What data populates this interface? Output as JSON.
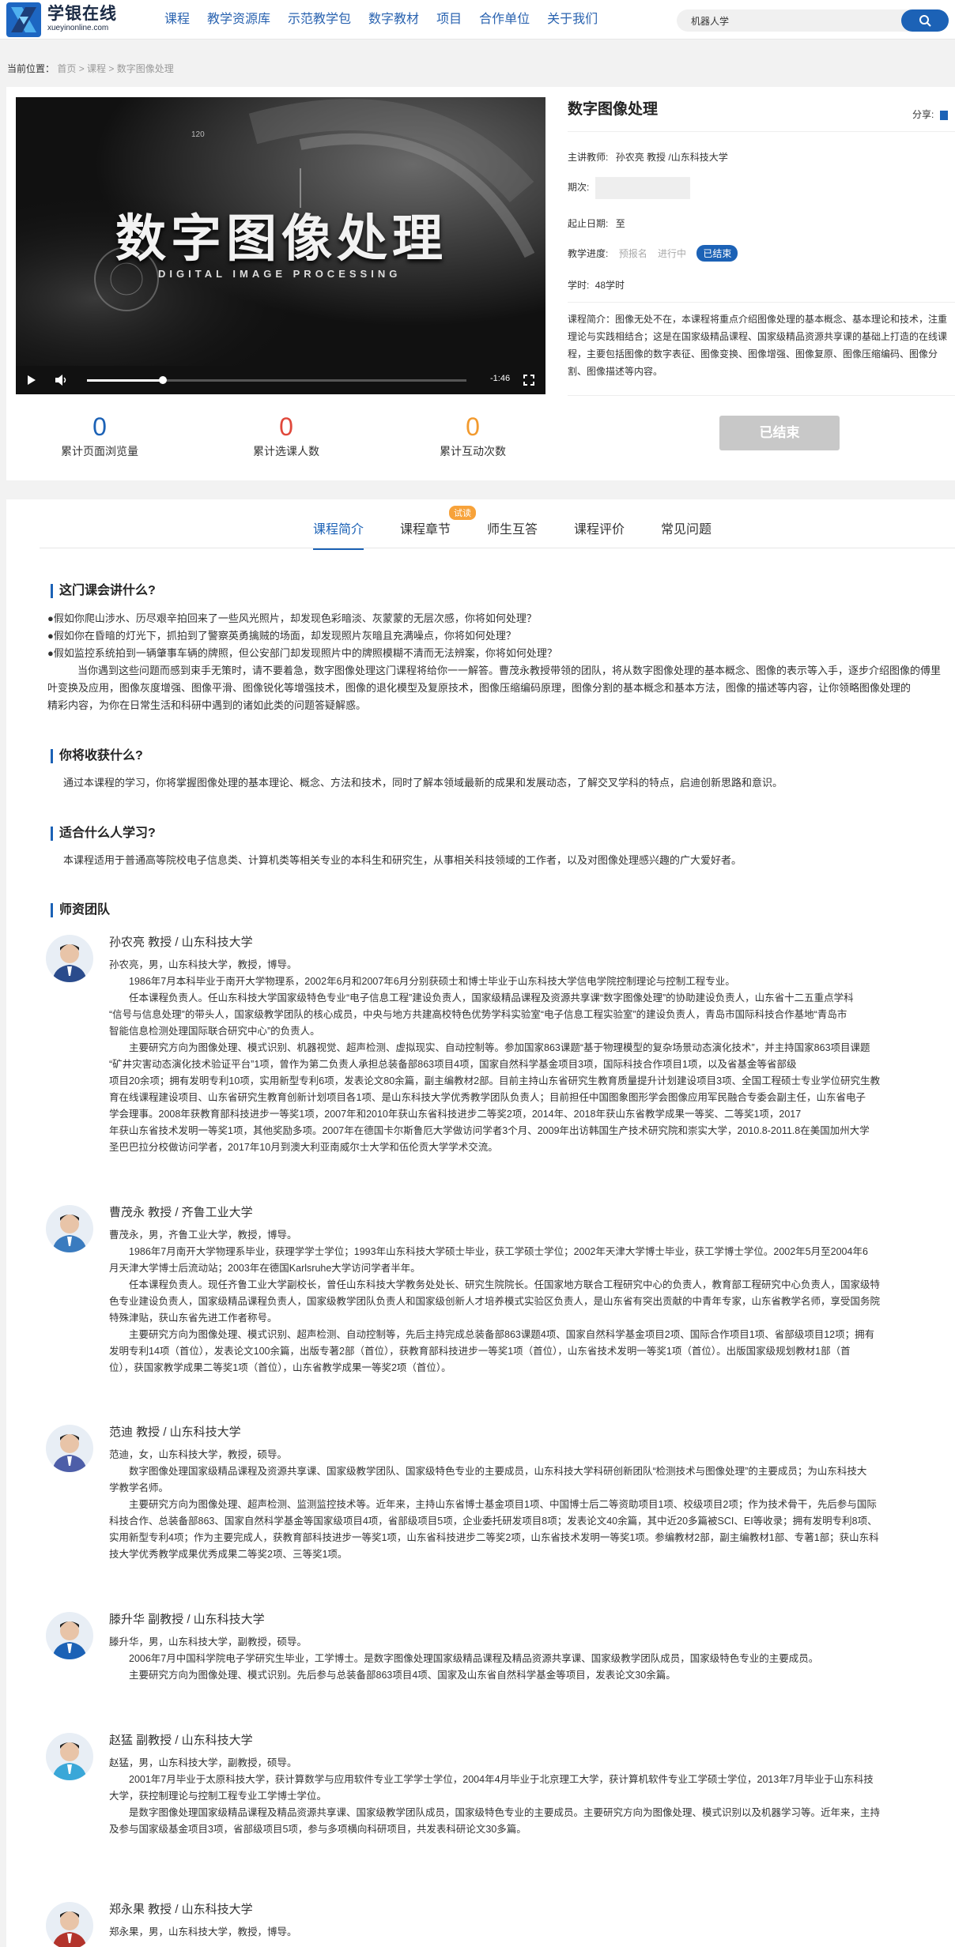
{
  "header": {
    "logo_title": "学银在线",
    "logo_sub": "xueyinonline.com",
    "nav": [
      "课程",
      "教学资源库",
      "示范教学包",
      "数字教材",
      "项目",
      "合作单位",
      "关于我们"
    ],
    "search_value": "机器人学"
  },
  "breadcrumb": {
    "label": "当前位置：",
    "path": "首页 > 课程 > 数字图像处理"
  },
  "video": {
    "title": "数字图像处理",
    "subtitle": "DIGITAL IMAGE PROCESSING",
    "num": "120",
    "time": "-1:46",
    "progress": 0.2
  },
  "course": {
    "title": "数字图像处理",
    "share": "分享:",
    "teacher_label": "主讲教师:",
    "teacher": "孙农亮 教授 /山东科技大学",
    "period_label": "期次:",
    "date_label": "起止日期:",
    "date": "至",
    "progress_label": "教学进度:",
    "steps": [
      "预报名",
      "进行中",
      "已结束"
    ],
    "hours_label": "学时:",
    "hours": "48学时",
    "intro": "课程简介：图像无处不在，本课程将重点介绍图像处理的基本概念、基本理论和技术，注重理论与实践相结合；这是在国家级精品课程、国家级精品资源共享课的基础上打造的在线课程，主要包括图像的数字表征、图像变换、图像增强、图像复原、图像压缩编码、图像分割、图像描述等内容。",
    "end_button": "已结束"
  },
  "stats": [
    {
      "value": "0",
      "label": "累计页面浏览量",
      "color": "#1c62b6"
    },
    {
      "value": "0",
      "label": "累计选课人数",
      "color": "#e0483b"
    },
    {
      "value": "0",
      "label": "累计互动次数",
      "color": "#f29a2e"
    }
  ],
  "tabs": [
    "课程简介",
    "课程章节",
    "师生互答",
    "课程评价",
    "常见问题"
  ],
  "tab_badge": "试读",
  "sections": {
    "s1_title": "这门课会讲什么?",
    "s1_bullets": [
      "●假如你爬山涉水、历尽艰辛拍回来了一些风光照片，却发现色彩暗淡、灰蒙蒙的无层次感，你将如何处理？",
      "●假如你在昏暗的灯光下，抓拍到了警察英勇擒贼的场面，却发现照片灰暗且充满噪点，你将如何处理？",
      "●假如监控系统拍到一辆肇事车辆的牌照，但公安部门却发现照片中的牌照模糊不清而无法辨案，你将如何处理？"
    ],
    "s1_para_1": "当你遇到这些问题而感到束手无策时，请不要着急，数字图像处理这门课程将给你一一解答。曹茂永教授带领的团队，将从数字图像处理的基本概念、图像的表示等入手，逐步介绍图像的傅里",
    "s1_para_2": "叶变换及应用，图像灰度增强、图像平滑、图像锐化等增强技术，图像的退化模型及复原技术，图像压缩编码原理，图像分割的基本概念和基本方法，图像的描述等内容，让你领略图像处理的",
    "s1_para_3": "精彩内容，为你在日常生活和科研中遇到的诸如此类的问题答疑解惑。",
    "s2_title": "你将收获什么?",
    "s2_para": "通过本课程的学习，你将掌握图像处理的基本理论、概念、方法和技术，同时了解本领域最新的成果和发展动态，了解交叉学科的特点，启迪创新思路和意识。",
    "s3_title": "适合什么人学习?",
    "s3_para": "本课程适用于普通高等院校电子信息类、计算机类等相关专业的本科生和研究生，从事相关科技领域的工作者，以及对图像处理感兴趣的广大爱好者。",
    "s4_title": "师资团队"
  },
  "teachers": [
    {
      "name": "孙农亮 教授 / 山东科技大学",
      "lines": [
        "孙农亮，男，山东科技大学，教授，博导。",
        "　　1986年7月本科毕业于南开大学物理系，2002年6月和2007年6月分别获硕士和博士毕业于山东科技大学信电学院控制理论与控制工程专业。",
        "　　任本课程负责人。任山东科技大学国家级特色专业“电子信息工程”建设负责人，国家级精品课程及资源共享课“数字图像处理”的协助建设负责人，山东省十二五重点学科",
        "“信号与信息处理”的带头人，国家级教学团队的核心成员，中央与地方共建高校特色优势学科实验室“电子信息工程实验室”的建设负责人，青岛市国际科技合作基地“青岛市",
        "智能信息检测处理国际联合研究中心”的负责人。",
        "　　主要研究方向为图像处理、模式识别、机器视觉、超声检测、虚拟现实、自动控制等。参加国家863课题“基于物理模型的复杂场景动态演化技术”，并主持国家863项目课题",
        "“矿井灾害动态演化技术验证平台”1项，曾作为第二负责人承担总装备部863项目4项，国家自然科学基金项目3项，国际科技合作项目1项，以及省基金等省部级",
        "项目20余项；拥有发明专利10项，实用新型专利6项，发表论文80余篇，副主编教材2部。目前主持山东省研究生教育质量提升计划建设项目3项、全国工程硕士专业学位研究生教",
        "育在线课程建设项目、山东省研究生教育创新计划项目各1项、是山东科技大学优秀教学团队负责人；目前担任中国图象图形学会图像应用军民融合专委会副主任，山东省电子",
        "学会理事。2008年获教育部科技进步一等奖1项，2007年和2010年获山东省科技进步二等奖2项，2014年、2018年获山东省教学成果一等奖、二等奖1项，2017",
        "年获山东省技术发明一等奖1项，其他奖励多项。2007年在德国卡尔斯鲁厄大学做访问学者3个月、2009年出访韩国生产技术研究院和崇实大学，2010.8-2011.8在美国加州大学",
        "圣巴巴拉分校做访问学者，2017年10月到澳大利亚南威尔士大学和伍伦贡大学学术交流。"
      ]
    },
    {
      "name": "曹茂永 教授 / 齐鲁工业大学",
      "lines": [
        "曹茂永，男，齐鲁工业大学，教授，博导。",
        "　　1986年7月南开大学物理系毕业，获理学学士学位；1993年山东科技大学硕士毕业，获工学硕士学位；2002年天津大学博士毕业，获工学博士学位。2002年5月至2004年6",
        "月天津大学博士后流动站；2003年在德国Karlsruhe大学访问学者半年。",
        "　　任本课程负责人。现任齐鲁工业大学副校长，曾任山东科技大学教务处处长、研究生院院长。任国家地方联合工程研究中心的负责人，教育部工程研究中心负责人，国家级特",
        "色专业建设负责人，国家级精品课程负责人，国家级教学团队负责人和国家级创新人才培养模式实验区负责人，是山东省有突出贡献的中青年专家，山东省教学名师，享受国务院",
        "特殊津贴，获山东省先进工作者称号。",
        "　　主要研究方向为图像处理、模式识别、超声检测、自动控制等，先后主持完成总装备部863课题4项、国家自然科学基金项目2项、国际合作项目1项、省部级项目12项；拥有",
        "发明专利14项（首位），发表论文100余篇，出版专著2部（首位），获教育部科技进步一等奖1项（首位），山东省技术发明一等奖1项（首位）。出版国家级规划教材1部（首",
        "位），获国家教学成果二等奖1项（首位），山东省教学成果一等奖2项（首位）。"
      ]
    },
    {
      "name": "范迪 教授 / 山东科技大学",
      "lines": [
        "范迪，女，山东科技大学，教授，硕导。",
        "　　数字图像处理国家级精品课程及资源共享课、国家级教学团队、国家级特色专业的主要成员，山东科技大学科研创新团队“检测技术与图像处理”的主要成员；为山东科技大",
        "学教学名师。",
        "　　主要研究方向为图像处理、超声检测、监测监控技术等。近年来，主持山东省博士基金项目1项、中国博士后二等资助项目1项、校级项目2项；作为技术骨干，先后参与国际",
        "科技合作、总装备部863、国家自然科学基金等国家级项目4项，省部级项目5项，企业委托研发项目8项；发表论文40余篇，其中近20多篇被SCI、EI等收录；拥有发明专利8项、",
        "实用新型专利4项；作为主要完成人，获教育部科技进步一等奖1项，山东省科技进步二等奖2项，山东省技术发明一等奖1项。参编教材2部，副主编教材1部、专著1部；获山东科",
        "技大学优秀教学成果优秀成果二等奖2项、三等奖1项。"
      ]
    },
    {
      "name": "滕升华 副教授 / 山东科技大学",
      "lines": [
        "滕升华，男，山东科技大学，副教授，硕导。",
        "　　2006年7月中国科学院电子学研究生毕业，工学博士。是数字图像处理国家级精品课程及精品资源共享课、国家级教学团队成员，国家级特色专业的主要成员。",
        "　　主要研究方向为图像处理、模式识别。先后参与总装备部863项目4项、国家及山东省自然科学基金等项目，发表论文30余篇。"
      ]
    },
    {
      "name": "赵猛 副教授 / 山东科技大学",
      "lines": [
        "赵猛，男，山东科技大学，副教授，硕导。",
        "　　2001年7月毕业于太原科技大学，获计算数学与应用软件专业工学学士学位，2004年4月毕业于北京理工大学，获计算机软件专业工学硕士学位，2013年7月毕业于山东科技",
        "大学，获控制理论与控制工程专业工学博士学位。",
        "　　是数字图像处理国家级精品课程及精品资源共享课、国家级教学团队成员，国家级特色专业的主要成员。主要研究方向为图像处理、模式识别以及机器学习等。近年来，主持",
        "及参与国家级基金项目3项，省部级项目5项，参与多项横向科研项目，共发表科研论文30多篇。"
      ]
    },
    {
      "name": "郑永果 教授 / 山东科技大学",
      "lines": [
        "郑永果，男，山东科技大学，教授，博导。"
      ]
    }
  ]
}
